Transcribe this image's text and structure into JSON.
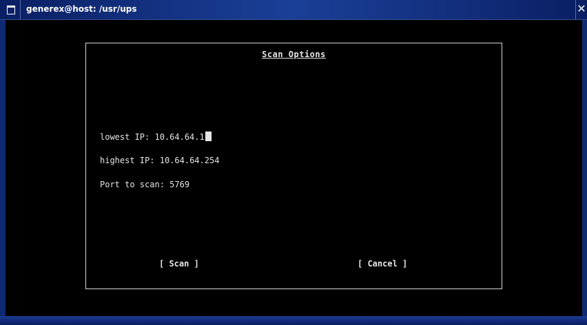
{
  "window": {
    "title": "generex@host: /usr/ups",
    "close_glyph": "✕"
  },
  "dialog": {
    "title": "Scan Options",
    "fields": [
      {
        "label": "lowest IP:",
        "value": "10.64.64.1"
      },
      {
        "label": "highest IP:",
        "value": "10.64.64.254"
      },
      {
        "label": "Port to scan:",
        "value": "5769"
      }
    ],
    "buttons": {
      "scan": "[ Scan ]",
      "cancel": "[ Cancel ]"
    }
  },
  "colors": {
    "titlebar": "#13307f",
    "terminal_bg": "#000000",
    "text": "#e6e6e6"
  }
}
